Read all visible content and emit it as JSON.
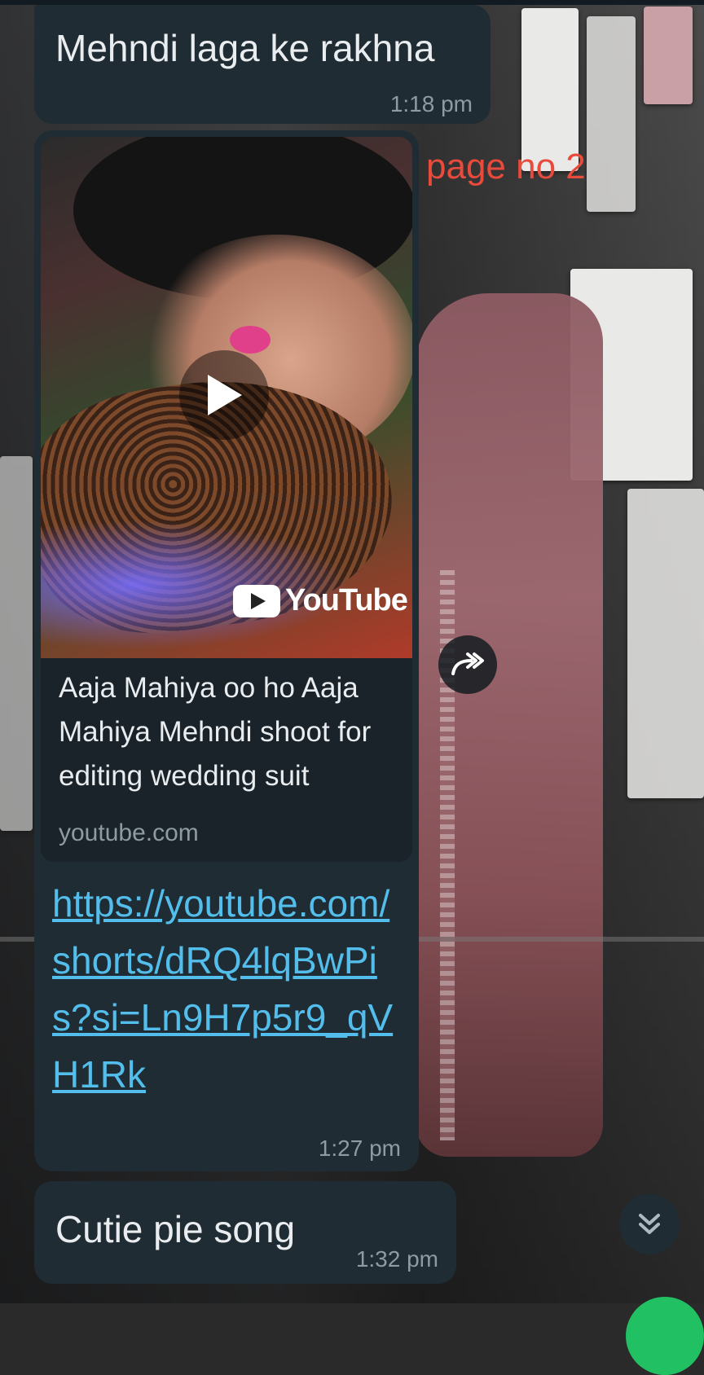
{
  "messages": [
    {
      "text": "Mehndi laga ke rakhna",
      "time": "1:18 pm"
    },
    {
      "link_preview": {
        "title": "Aaja Mahiya oo ho Aaja Mahiya Mehndi shoot for editing wedding suit",
        "domain": "youtube.com",
        "brand": "YouTube"
      },
      "link_text": "https://youtube.com/shorts/dRQ4lqBwPis?si=Ln9H7p5r9_qVH1Rk",
      "time": "1:27 pm"
    },
    {
      "text": "Cutie pie song",
      "time": "1:32 pm"
    }
  ],
  "overlay_note": "page no 2",
  "icons": {
    "play": "play-icon",
    "forward": "forward-icon",
    "scroll_down": "double-chevron-down-icon"
  },
  "colors": {
    "bubble": "#1f2c33",
    "link": "#53bdeb",
    "timestamp": "#8e9ba3",
    "note": "#e84a3c"
  }
}
